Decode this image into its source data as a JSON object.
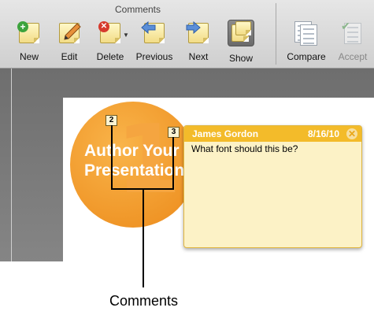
{
  "toolbar": {
    "group_title": "Comments",
    "buttons": [
      {
        "id": "new",
        "label": "New",
        "icon": "new-comment-icon"
      },
      {
        "id": "edit",
        "label": "Edit",
        "icon": "edit-comment-icon"
      },
      {
        "id": "delete",
        "label": "Delete",
        "icon": "delete-comment-icon"
      },
      {
        "id": "previous",
        "label": "Previous",
        "icon": "previous-comment-icon"
      },
      {
        "id": "next",
        "label": "Next",
        "icon": "next-comment-icon"
      },
      {
        "id": "show",
        "label": "Show",
        "icon": "show-comments-icon",
        "active": true
      },
      {
        "id": "compare",
        "label": "Compare",
        "icon": "compare-icon"
      },
      {
        "id": "accept",
        "label": "Accept",
        "icon": "accept-icon",
        "disabled": true
      }
    ]
  },
  "slide": {
    "number_glyph": "1",
    "title_line1": "Author Your",
    "title_line2": "Presentation"
  },
  "markers": [
    {
      "label": "2"
    },
    {
      "label": "3"
    }
  ],
  "comment": {
    "author": "James Gordon",
    "date": "8/16/10",
    "text": "What font should this be?",
    "close_glyph": "✕"
  },
  "callout": {
    "label": "Comments"
  },
  "colors": {
    "slide_accent": "#ec8a1a",
    "comment_header": "#f3bb2a",
    "comment_body": "#fcf2c6"
  }
}
